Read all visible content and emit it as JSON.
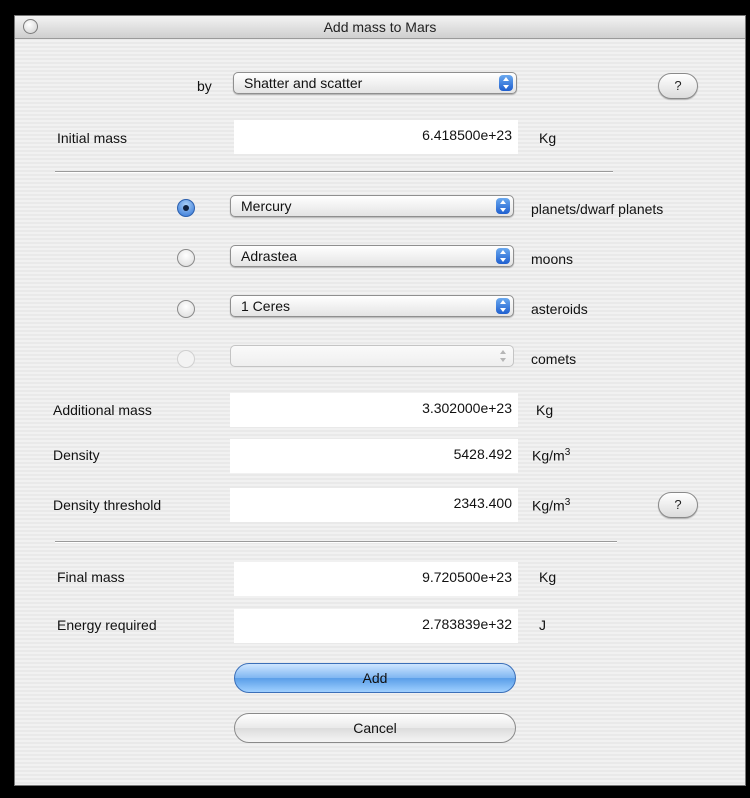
{
  "window": {
    "title": "Add mass to Mars"
  },
  "method": {
    "label": "by",
    "value": "Shatter and scatter"
  },
  "help_label": "?",
  "initial_mass": {
    "label": "Initial mass",
    "value": "6.418500e+23",
    "unit": "Kg"
  },
  "sources": [
    {
      "value": "Mercury",
      "category": "planets/dwarf planets",
      "selected": true,
      "enabled": true
    },
    {
      "value": "Adrastea",
      "category": "moons",
      "selected": false,
      "enabled": true
    },
    {
      "value": "1 Ceres",
      "category": "asteroids",
      "selected": false,
      "enabled": true
    },
    {
      "value": "",
      "category": "comets",
      "selected": false,
      "enabled": false
    }
  ],
  "additional_mass": {
    "label": "Additional mass",
    "value": "3.302000e+23",
    "unit": "Kg"
  },
  "density": {
    "label": "Density",
    "value": "5428.492",
    "unit": "Kg/m",
    "unit_exp": "3"
  },
  "density_threshold": {
    "label": "Density threshold",
    "value": "2343.400",
    "unit": "Kg/m",
    "unit_exp": "3"
  },
  "final_mass": {
    "label": "Final mass",
    "value": "9.720500e+23",
    "unit": "Kg"
  },
  "energy_required": {
    "label": "Energy required",
    "value": "2.783839e+32",
    "unit": "J"
  },
  "buttons": {
    "add": "Add",
    "cancel": "Cancel"
  }
}
